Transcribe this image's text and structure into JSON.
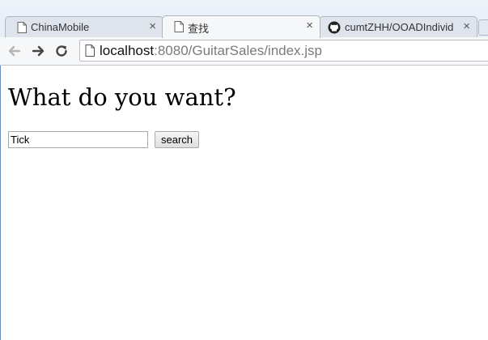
{
  "tabs": [
    {
      "title": "ChinaMobile",
      "close": "×",
      "favicon": "page-icon"
    },
    {
      "title": "查找",
      "close": "×",
      "favicon": "page-icon"
    },
    {
      "title": "cumtZHH/OOADIndivid",
      "close": "×",
      "favicon": "github-icon"
    }
  ],
  "toolbar": {
    "url_host": "localhost",
    "url_rest": ":8080/GuitarSales/index.jsp",
    "back_icon": "back-arrow-icon",
    "forward_icon": "forward-arrow-icon",
    "reload_icon": "reload-icon"
  },
  "page": {
    "heading": "What do you want?",
    "search_value": "Tick",
    "search_button": "search"
  }
}
